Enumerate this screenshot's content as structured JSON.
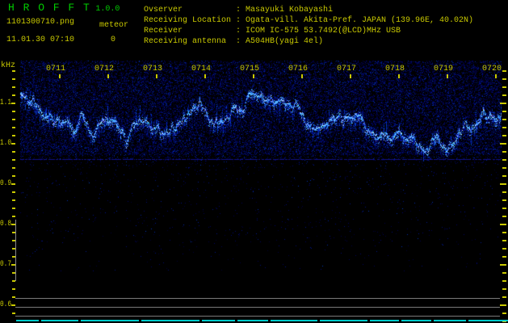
{
  "header": {
    "app_title": "H R O F F T",
    "version": "1.0.0",
    "filename": "1101300710.png",
    "datetime": "11.01.30 07:10",
    "meteor_label": "meteor",
    "meteor_count": "0",
    "info_rows": [
      {
        "label": "Ovserver",
        "value": "Masayuki Kobayashi"
      },
      {
        "label": "Receiving Location",
        "value": "Ogata-vill. Akita-Pref. JAPAN (139.96E, 40.02N)"
      },
      {
        "label": "Receiver",
        "value": "ICOM IC-575 53.7492(@LCD)MHz USB"
      },
      {
        "label": "Receiving antenna",
        "value": "A504HB(yagi 4el)"
      }
    ]
  },
  "colors": {
    "text_yellow": "#c9c900",
    "text_green": "#00cc00",
    "gray_line": "#7a7a7a",
    "cyan_marker": "#00cccc",
    "background": "#000000"
  },
  "chart_data": {
    "type": "heatmap",
    "subtype": "radio-meteor-spectrogram",
    "title": "HROFFT 10-minute spectrogram 0710-0720 JST",
    "x_axis": {
      "unit": "time HHMM",
      "tick_labels": [
        "0711",
        "0712",
        "0713",
        "0714",
        "0715",
        "0716",
        "0717",
        "0718",
        "0719",
        "0720"
      ],
      "minutes_per_division": 1
    },
    "y_axis": {
      "label": "kHz",
      "tick_labels": [
        "1.1",
        "1.0",
        "0.9",
        "0.8",
        "0.7",
        "0.6"
      ],
      "range_khz": [
        0.56,
        1.2
      ],
      "minor_tick_khz": 0.02
    },
    "signal": {
      "description": "continuous blue noise band with bright jagged carrier ridge near 1.0-1.1 kHz, sparse noise below 0.95 kHz, no meteor echoes",
      "band_top_khz": 1.2,
      "band_bottom_khz": 0.95,
      "ridge_center_khz": 1.05,
      "meteor_echo_count": 0
    },
    "noise_seed": 1130
  }
}
